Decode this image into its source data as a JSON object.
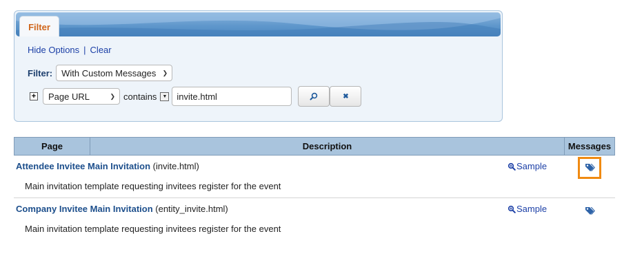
{
  "filter": {
    "tab_label": "Filter",
    "hide_options_link": "Hide Options",
    "separator": "|",
    "clear_link": "Clear",
    "filter_label": "Filter:",
    "filter_select_value": "With Custom Messages",
    "add_condition": "+",
    "field_select_value": "Page URL",
    "operator": "contains",
    "operator_dropdown": "▼",
    "value_input": "invite.html",
    "search_button_icon": "search-icon",
    "clear_button_icon": "close-icon",
    "clear_button_glyph": "✖"
  },
  "table": {
    "headers": {
      "page": "Page",
      "description": "Description",
      "messages": "Messages"
    },
    "rows": [
      {
        "title": "Attendee Invitee Main Invitation",
        "file": "(invite.html)",
        "description": "Main invitation template requesting invitees register for the event",
        "sample_label": "Sample",
        "messages_icon": "tags-icon",
        "highlighted": true
      },
      {
        "title": "Company Invitee Main Invitation",
        "file": "(entity_invite.html)",
        "description": "Main invitation template requesting invitees register for the event",
        "sample_label": "Sample",
        "messages_icon": "tags-icon",
        "highlighted": false
      }
    ]
  },
  "colors": {
    "accent_orange": "#f08a12",
    "link_blue": "#1b3fa6",
    "title_blue": "#1d4f8c",
    "header_bg": "#a9c4dd"
  }
}
